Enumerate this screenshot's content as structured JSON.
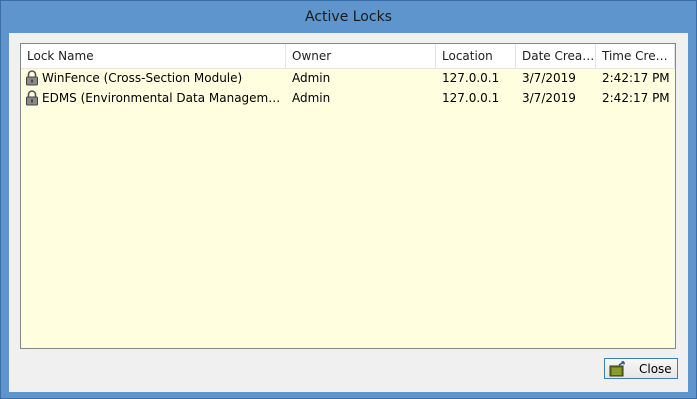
{
  "window": {
    "title": "Active Locks"
  },
  "table": {
    "columns": [
      "Lock Name",
      "Owner",
      "Location",
      "Date Created",
      "Time Creat..."
    ],
    "rows": [
      {
        "lock_name": "WinFence (Cross-Section Module)",
        "owner": "Admin",
        "location": "127.0.0.1",
        "date_created": "3/7/2019",
        "time_created": "2:42:17 PM"
      },
      {
        "lock_name": "EDMS (Environmental Data Management S...",
        "owner": "Admin",
        "location": "127.0.0.1",
        "date_created": "3/7/2019",
        "time_created": "2:42:17 PM"
      }
    ],
    "row_icon": "padlock-icon"
  },
  "buttons": {
    "close_label": "Close",
    "close_icon": "exit-door-icon"
  },
  "colors": {
    "frame": "#5d95cc",
    "list_background": "#ffffe0",
    "button_border": "#3c7fb1"
  }
}
